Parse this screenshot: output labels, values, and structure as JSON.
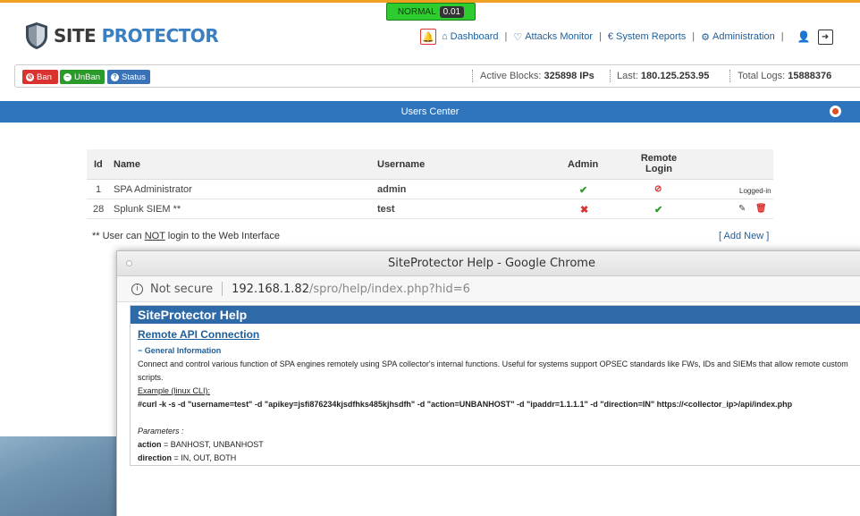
{
  "status": {
    "label": "NORMAL",
    "value": "0.01"
  },
  "logo": {
    "word1": "SITE",
    "word2": "PROTECTOR"
  },
  "nav": {
    "dashboard": "Dashboard",
    "attacks_monitor": "Attacks Monitor",
    "system_reports": "System Reports",
    "administration": "Administration",
    "separator": "|"
  },
  "actions": {
    "ban": "Ban",
    "unban": "UnBan",
    "status": "Status"
  },
  "stats": {
    "active_blocks_label": "Active Blocks:",
    "active_blocks_value": "325898 IPs",
    "last_label": "Last:",
    "last_value": "180.125.253.95",
    "total_logs_label": "Total Logs:",
    "total_logs_value": "15888376"
  },
  "users_center": {
    "title": "Users Center"
  },
  "table": {
    "headers": {
      "id": "Id",
      "name": "Name",
      "username": "Username",
      "admin": "Admin",
      "remote_login": "Remote Login"
    },
    "rows": [
      {
        "id": "1",
        "name": "SPA Administrator",
        "username": "admin",
        "admin": "yes",
        "remote": "no",
        "status": "Logged-in"
      },
      {
        "id": "28",
        "name": "Splunk SIEM **",
        "username": "test",
        "admin": "no",
        "remote": "yes",
        "status": ""
      }
    ]
  },
  "note": {
    "prefix": "** User can ",
    "not": "NOT",
    "suffix": " login to the Web Interface"
  },
  "add_new": "[ Add New ]",
  "popup": {
    "window_title": "SiteProtector Help - Google Chrome",
    "not_secure": "Not secure",
    "url_host": "192.168.1.82",
    "url_path": "/spro/help/index.php?hid=6",
    "help_title": "SiteProtector Help",
    "section_link": "Remote API Connection",
    "general_info": "− General Information",
    "description": "Connect and control various function of SPA engines remotely using SPA collector's internal functions. Useful for systems support OPSEC standards like FWs, IDs and SIEMs that allow remote custom scripts.",
    "example_label": "Example (linux CLI):",
    "curl": "#curl -k -s -d \"username=test\" -d \"apikey=jsfi876234kjsdfhks485kjhsdfh\" -d \"action=UNBANHOST\" -d \"ipaddr=1.1.1.1\" -d \"direction=IN\" https://<collector_ip>/api/index.php",
    "parameters_label": "Parameters :",
    "action_key": "action",
    "action_value": " = BANHOST, UNBANHOST",
    "direction_key": "direction",
    "direction_value": " = IN, OUT, BOTH"
  },
  "colors": {
    "accent": "#2f75bd",
    "ban": "#d9322f",
    "unban": "#2a9a2a",
    "status": "#3a72b8"
  }
}
